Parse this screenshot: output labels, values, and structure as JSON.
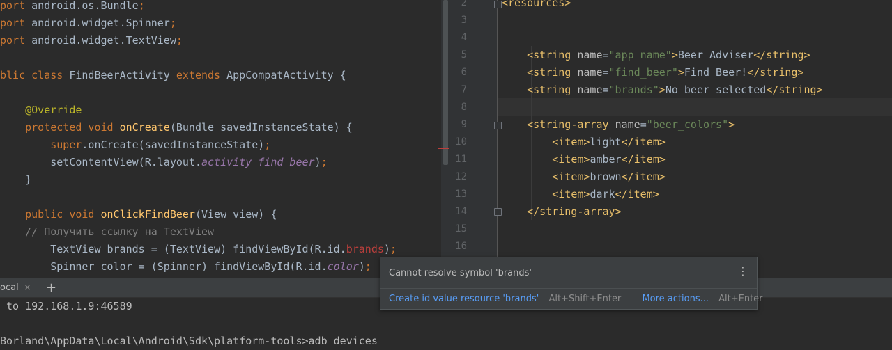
{
  "left_editor": {
    "lines": [
      [
        {
          "t": "port",
          "c": "k"
        },
        {
          "t": " android.os.Bundle",
          "c": ""
        },
        {
          "t": ";",
          "c": "k"
        }
      ],
      [
        {
          "t": "port",
          "c": "k"
        },
        {
          "t": " android.widget.Spinner",
          "c": ""
        },
        {
          "t": ";",
          "c": "k"
        }
      ],
      [
        {
          "t": "port",
          "c": "k"
        },
        {
          "t": " android.widget.TextView",
          "c": ""
        },
        {
          "t": ";",
          "c": "k"
        }
      ],
      [],
      [
        {
          "t": "blic class",
          "c": "k"
        },
        {
          "t": " FindBeerActivity ",
          "c": ""
        },
        {
          "t": "extends",
          "c": "k"
        },
        {
          "t": " AppCompatActivity {",
          "c": ""
        }
      ],
      [],
      [
        {
          "t": "    ",
          "c": ""
        },
        {
          "t": "@Override",
          "c": "an"
        }
      ],
      [
        {
          "t": "    ",
          "c": ""
        },
        {
          "t": "protected void",
          "c": "k"
        },
        {
          "t": " ",
          "c": ""
        },
        {
          "t": "onCreate",
          "c": "fn"
        },
        {
          "t": "(Bundle savedInstanceState) {",
          "c": ""
        }
      ],
      [
        {
          "t": "        ",
          "c": ""
        },
        {
          "t": "super",
          "c": "k"
        },
        {
          "t": ".onCreate(savedInstanceState)",
          "c": ""
        },
        {
          "t": ";",
          "c": "k"
        }
      ],
      [
        {
          "t": "        setContentView(R.layout.",
          "c": ""
        },
        {
          "t": "activity_find_beer",
          "c": "fld"
        },
        {
          "t": ")",
          "c": ""
        },
        {
          "t": ";",
          "c": "k"
        }
      ],
      [
        {
          "t": "    }",
          "c": ""
        }
      ],
      [],
      [
        {
          "t": "    ",
          "c": ""
        },
        {
          "t": "public void",
          "c": "k"
        },
        {
          "t": " ",
          "c": ""
        },
        {
          "t": "onClickFindBeer",
          "c": "fn"
        },
        {
          "t": "(View view) {",
          "c": ""
        }
      ],
      [
        {
          "t": "    ",
          "c": ""
        },
        {
          "t": "// Получить ссылку на TextView",
          "c": "cm"
        }
      ],
      [
        {
          "t": "        TextView brands = (TextView) findViewById(R.id.",
          "c": ""
        },
        {
          "t": "brands",
          "c": "err"
        },
        {
          "t": ")",
          "c": ""
        },
        {
          "t": ";",
          "c": "k"
        }
      ],
      [
        {
          "t": "        Spinner color = (Spinner) findViewById(R.id.",
          "c": ""
        },
        {
          "t": "color",
          "c": "fld"
        },
        {
          "t": ")",
          "c": ""
        },
        {
          "t": ";",
          "c": "k"
        }
      ]
    ]
  },
  "right_editor": {
    "line_numbers": [
      "2",
      "3",
      "4",
      "5",
      "6",
      "7",
      "8",
      "9",
      "10",
      "11",
      "12",
      "13",
      "14",
      "15",
      "16"
    ],
    "lines": [
      [
        {
          "t": "<resources>",
          "c": "tg"
        }
      ],
      [],
      [],
      [
        {
          "t": "    ",
          "c": ""
        },
        {
          "t": "<string ",
          "c": "tg"
        },
        {
          "t": "name",
          "c": "at"
        },
        {
          "t": "=",
          "c": ""
        },
        {
          "t": "\"app_name\"",
          "c": "str"
        },
        {
          "t": ">",
          "c": "tg"
        },
        {
          "t": "Beer Adviser",
          "c": ""
        },
        {
          "t": "</string>",
          "c": "tg"
        }
      ],
      [
        {
          "t": "    ",
          "c": ""
        },
        {
          "t": "<string ",
          "c": "tg"
        },
        {
          "t": "name",
          "c": "at"
        },
        {
          "t": "=",
          "c": ""
        },
        {
          "t": "\"find_beer\"",
          "c": "str"
        },
        {
          "t": ">",
          "c": "tg"
        },
        {
          "t": "Find Beer!",
          "c": ""
        },
        {
          "t": "</string>",
          "c": "tg"
        }
      ],
      [
        {
          "t": "    ",
          "c": ""
        },
        {
          "t": "<string ",
          "c": "tg"
        },
        {
          "t": "name",
          "c": "at"
        },
        {
          "t": "=",
          "c": ""
        },
        {
          "t": "\"brands\"",
          "c": "str"
        },
        {
          "t": ">",
          "c": "tg"
        },
        {
          "t": "No beer selected",
          "c": ""
        },
        {
          "t": "</string>",
          "c": "tg"
        }
      ],
      [],
      [
        {
          "t": "    ",
          "c": ""
        },
        {
          "t": "<string-array ",
          "c": "tg"
        },
        {
          "t": "name",
          "c": "at"
        },
        {
          "t": "=",
          "c": ""
        },
        {
          "t": "\"beer_colors\"",
          "c": "str"
        },
        {
          "t": ">",
          "c": "tg"
        }
      ],
      [
        {
          "t": "        ",
          "c": ""
        },
        {
          "t": "<item>",
          "c": "tg"
        },
        {
          "t": "light",
          "c": ""
        },
        {
          "t": "</item>",
          "c": "tg"
        }
      ],
      [
        {
          "t": "        ",
          "c": ""
        },
        {
          "t": "<item>",
          "c": "tg"
        },
        {
          "t": "amber",
          "c": ""
        },
        {
          "t": "</item>",
          "c": "tg"
        }
      ],
      [
        {
          "t": "        ",
          "c": ""
        },
        {
          "t": "<item>",
          "c": "tg"
        },
        {
          "t": "brown",
          "c": ""
        },
        {
          "t": "</item>",
          "c": "tg"
        }
      ],
      [
        {
          "t": "        ",
          "c": ""
        },
        {
          "t": "<item>",
          "c": "tg"
        },
        {
          "t": "dark",
          "c": ""
        },
        {
          "t": "</item>",
          "c": "tg"
        }
      ],
      [
        {
          "t": "    ",
          "c": ""
        },
        {
          "t": "</string-array>",
          "c": "tg"
        }
      ],
      [],
      []
    ]
  },
  "terminal": {
    "tab_label": "ocal",
    "close_symbol": "×",
    "add_symbol": "+",
    "lines": [
      " to 192.168.1.9:46589",
      "",
      "Borland\\AppData\\Local\\Android\\Sdk\\platform-tools>adb devices"
    ]
  },
  "popup": {
    "message": "Cannot resolve symbol 'brands'",
    "menu_symbol": "⋮",
    "primary_action": "Create id value resource 'brands'",
    "primary_shortcut": "Alt+Shift+Enter",
    "more_action": "More actions...",
    "more_shortcut": "Alt+Enter"
  },
  "colors": {
    "background": "#2b2b2b",
    "keyword": "#cc7832",
    "method": "#ffc66d",
    "string": "#6a8759",
    "tag": "#e8bf6a",
    "error": "#bc3f3c",
    "link": "#589df6"
  }
}
